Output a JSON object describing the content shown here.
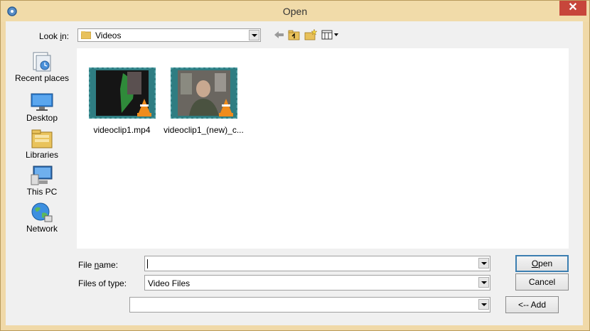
{
  "window": {
    "title": "Open",
    "close_glyph": "✕"
  },
  "toolbar": {
    "look_in_prefix": "Look ",
    "look_in_ul": "i",
    "look_in_suffix": "n:",
    "current_folder": "Videos",
    "icons": [
      "back-arrow-icon",
      "up-folder-icon",
      "new-folder-icon",
      "view-menu-icon"
    ]
  },
  "places": [
    {
      "label": "Recent places",
      "icon": "recent-places-icon"
    },
    {
      "label": "Desktop",
      "icon": "desktop-icon"
    },
    {
      "label": "Libraries",
      "icon": "libraries-icon"
    },
    {
      "label": "This PC",
      "icon": "this-pc-icon"
    },
    {
      "label": "Network",
      "icon": "network-icon"
    }
  ],
  "files": [
    {
      "name": "videoclip1.mp4"
    },
    {
      "name": "videoclip1_(new)_c..."
    }
  ],
  "form": {
    "file_name_label_pre": "File ",
    "file_name_label_ul": "n",
    "file_name_label_post": "ame:",
    "file_name_value": "",
    "file_type_label": "Files of type:",
    "file_type_value": "Video Files",
    "extra_value": ""
  },
  "buttons": {
    "open_ul": "O",
    "open_rest": "pen",
    "cancel": "Cancel",
    "add": "<-- Add"
  },
  "colors": {
    "frame": "#f0d9a8",
    "close": "#c7463b",
    "focus": "#3c7fb1"
  }
}
